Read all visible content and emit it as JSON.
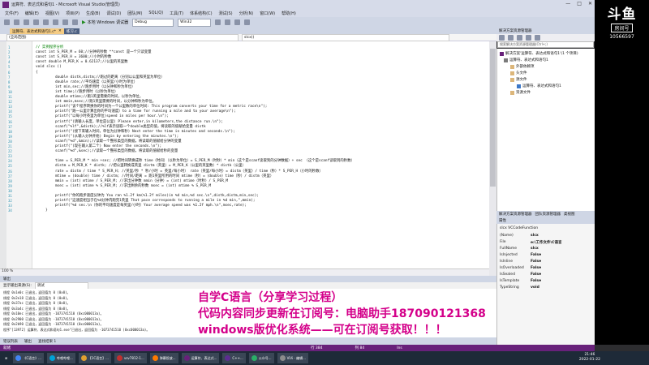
{
  "window": {
    "title": "运算符、表达式和语句1 - Microsoft Visual Studio(管理员)",
    "controls": [
      "—",
      "□",
      "✕"
    ]
  },
  "menu": [
    "文件(F)",
    "编辑(E)",
    "视图(V)",
    "项目(P)",
    "生成(B)",
    "调试(D)",
    "团队(M)",
    "SQL(Q)",
    "工具(T)",
    "体系结构(C)",
    "测试(S)",
    "分析(N)",
    "窗口(W)",
    "帮助(H)"
  ],
  "toolbar": {
    "run_label": "本地 Windows 调试器",
    "config": "Debug",
    "platform": "Win32"
  },
  "branding": {
    "logo_text": "斗鱼",
    "tag": "房间号",
    "room": "10566597"
  },
  "tabs": [
    {
      "label": "运算符、表达式和语句1.c*",
      "active": true
    },
    {
      "label": "练习.c",
      "active": false
    }
  ],
  "nav": {
    "scope": "(全局范围)",
    "func": "slcx()"
  },
  "code": {
    "line_numbers": [
      "1",
      "2",
      "3",
      "4",
      "5",
      "6",
      "7",
      "8",
      "9",
      "10",
      "11",
      "12",
      "13",
      "14",
      "15",
      "16",
      "17",
      "18",
      "19",
      "20",
      "21",
      "22",
      "23",
      "24",
      "25",
      "26",
      "27",
      "28",
      "29",
      "30",
      "31",
      "32",
      "33",
      "34",
      "35",
      "36",
      "37",
      "38",
      "39",
      "40",
      "41",
      "42"
    ],
    "lines": [
      {
        "indent": 0,
        "cls": "cm",
        "text": "// 实例程序分析"
      },
      {
        "indent": 0,
        "cls": "tx",
        "text": "const int S_PER_M = 60;//分钟的秒数  **const 是一个只读变量"
      },
      {
        "indent": 0,
        "cls": "tx",
        "text": "const int S_PER_H = 3600;//小时的秒数"
      },
      {
        "indent": 0,
        "cls": "tx",
        "text": "const double M_PER_K = 0.62137;//公里的英里数"
      },
      {
        "indent": 0,
        "cls": "tx",
        "text": "void slcx ()"
      },
      {
        "indent": 0,
        "cls": "tx",
        "text": "{"
      },
      {
        "indent": 2,
        "cls": "tx",
        "text": "double distk,distm;//跑过的距离（分别以公里和英里为单位）"
      },
      {
        "indent": 2,
        "cls": "tx",
        "text": "double rate;//平均速度（以英里/小时为单位）"
      },
      {
        "indent": 2,
        "cls": "tx",
        "text": "int min,sec;//跑步用时（以分钟和秒为单位）"
      },
      {
        "indent": 2,
        "cls": "tx",
        "text": "int time;//跑步用时（以秒为单位）"
      },
      {
        "indent": 2,
        "cls": "tx",
        "text": "double mtime;//跑1英里需要的时间，以秒为单位。"
      },
      {
        "indent": 2,
        "cls": "tx",
        "text": "int mmin,msec;//跑1英里需要的时间，以分钟和秒为单位。"
      },
      {
        "indent": 2,
        "cls": "tx",
        "text": "printf(\"该个程序转换你的时间为一个公里数的单位时间: This program converts your time for a metric race\\n\");"
      },
      {
        "indent": 2,
        "cls": "tx",
        "text": "printf(\"跑一公里计算出你的平均速度）to a time for running a mile and to your average\\n\");"
      },
      {
        "indent": 2,
        "cls": "tx",
        "text": "printf(\"以每小时英里为单位)speed in miles per hour.\\n\");"
      },
      {
        "indent": 2,
        "cls": "tx",
        "text": "printf(\"(请输入长度，单位是公里) Please enter,in kilometers,the distance run.\\n\");"
      },
      {
        "indent": 2,
        "cls": "tx",
        "text": "scanf(\"%lf\",&distk);//%lf表示读取一个double类型的值，将读取的值赋给变量 distk"
      },
      {
        "indent": 2,
        "cls": "tx",
        "text": "printf(\"(接下来输入时间，单位为分钟和秒) Next enter the time in minutes and seconds.\\n\");"
      },
      {
        "indent": 2,
        "cls": "tx",
        "text": "printf(\"(从输入分钟开始) Begin by entering the minutes.\\n\");"
      },
      {
        "indent": 2,
        "cls": "tx",
        "text": "scanf(\"%d\",&min);//读取一个整形类型的数据，将读取的值赋给分钟的变量"
      },
      {
        "indent": 2,
        "cls": "tx",
        "text": "printf(\"(现在输入第二个) Now enter the seconds.\\n\");"
      },
      {
        "indent": 2,
        "cls": "tx",
        "text": "scanf(\"%d\",&sec);//读取一个整形类型的数据，将读取的值赋给秒的变量"
      },
      {
        "indent": 0,
        "cls": "tx",
        "text": ""
      },
      {
        "indent": 2,
        "cls": "tx",
        "text": "time = S_PER_M * min +sec;     //把时间转换成秒  time（时间）（以秒为单位）= S_PER_M（时秒）* min（这个是scanf读取到的分钟数据）+ sec （这个是scanf读取到的秒数）"
      },
      {
        "indent": 2,
        "cls": "tx",
        "text": "distm = M_PER_K * distk;       //把公里转换成英里 distm（英里）= M_PER_K（公里的英里数）* distk（公里）"
      },
      {
        "indent": 2,
        "cls": "tx",
        "text": "rate = distm / time * S_PER_H; //英里/秒 * 秒/小时 = 英里/每小时） rate（英里/每小时）= distm（英里）/ time（秒）* S_PER_H（小时的秒数）"
      },
      {
        "indent": 2,
        "cls": "tx",
        "text": "mtime = (double) time / distm; //时间/距离 = 跑1英里所用的时间  mtime（秒）=（double）time（秒）/ distm（英里）"
      },
      {
        "indent": 2,
        "cls": "tx",
        "text": "mmin = (int) mtime / S_PER_M;  //求出分钟数  mmin（分钟）= (int) mtime（时秒）/ S_PER_M"
      },
      {
        "indent": 2,
        "cls": "tx",
        "text": "msec = (int) mtime % S_PER_M;  //求出剩余的秒数    msec = (int) mtime % S_PER_M"
      },
      {
        "indent": 0,
        "cls": "tx",
        "text": ""
      },
      {
        "indent": 2,
        "cls": "tx",
        "text": "printf(\"你的跑步速度分钟为 You ran %1.2f km(%1.2f miles)in %d min,%d sec.\\n\",distk,distm,min,sec);"
      },
      {
        "indent": 2,
        "cls": "tx",
        "text": "printf(\"这速度相当于在%d分钟内跑完1英里 That pace corresponds to running a mile in %d min,\",mmin);"
      },
      {
        "indent": 2,
        "cls": "tx",
        "text": "printf(\"%d sec.\\n（你的平均速度是每英里/小时）Your average speed was %1.2f mph.\\n\",msec,rate);"
      },
      {
        "indent": 1,
        "cls": "tx",
        "text": "}"
      }
    ]
  },
  "editor": {
    "zoom": "100 %"
  },
  "output": {
    "header": "输出",
    "source_label": "显示输出来源(S):",
    "source_value": "调试",
    "lines": [
      "线程 0x1e0c 已退出，返回值为 0 (0x0)。",
      "线程 0x2e18 已退出，返回值为 0 (0x0)。",
      "线程 0x37ac 已退出，返回值为 0 (0x0)。",
      "线程 0x3a4c 已退出，返回值为 0 (0x0)。",
      "线程 0x10ec 已退出，返回值为 -1073741510 (0xc000013a)。",
      "线程 0x2900 已退出，返回值为 -1073741510 (0xc000013a)。",
      "线程 0x2b90 已退出，返回值为 -1073741510 (0xc000013a)。",
      "程序\"[13972] 运算符、表达式和语句1.exe\"已退出，返回值为 -1073741510 (0xc000013a)。"
    ],
    "tabs": [
      "错误列表",
      "输出",
      "查找结果 1"
    ]
  },
  "overlay": {
    "line1": "自学C语言（分享学习过程）",
    "line2": "代码内容同步更新在订阅号：电脑助手187090121368",
    "line3": "windows版优化系统——可在订阅号获取！！！"
  },
  "solution": {
    "header": "解决方案资源管理器",
    "search_placeholder": "搜索解决方案资源管理器(Ctrl+;)",
    "items": [
      "解决方案'运算符、表达式和语句1'(1 个项目)",
      "运算符、表达式和语句1",
      "外部依赖项",
      "头文件",
      "源文件",
      "运算符、表达式和语句1",
      "资源文件"
    ],
    "footer_tabs": [
      "解决方案资源管理器",
      "团队资源管理器",
      "类视图"
    ]
  },
  "properties": {
    "header": "属性",
    "object": "slcx VCCodeFunction",
    "rows": [
      {
        "k": "(Name)",
        "v": "slcx"
      },
      {
        "k": "File",
        "v": "e:\\工作文件\\C语言"
      },
      {
        "k": "FullName",
        "v": "slcx"
      },
      {
        "k": "IsInjected",
        "v": "False"
      },
      {
        "k": "IsInline",
        "v": "False"
      },
      {
        "k": "IsOverloaded",
        "v": "False"
      },
      {
        "k": "IsSealed",
        "v": "False"
      },
      {
        "k": "IsTemplate",
        "v": "False"
      },
      {
        "k": "TypeString",
        "v": "void"
      }
    ]
  },
  "statusbar": {
    "left": "就绪",
    "row": "行 384",
    "col": "列 84",
    "mode": "Ins"
  },
  "taskbar": {
    "items": [
      "《C语言》...",
      "哔哩哔哩...",
      "【1C语言】...",
      "vsv7812-1...",
      "弹幕投放...",
      "运算符、表达式...",
      "C++...",
      "公众号...",
      "ViVi - 编辑..."
    ],
    "time": "21:46",
    "date": "2022-01-22"
  },
  "colors": {
    "vs_purple": "#68217a",
    "overlay": "#d4008a",
    "keyword": "#0000ff",
    "comment": "#008000"
  }
}
